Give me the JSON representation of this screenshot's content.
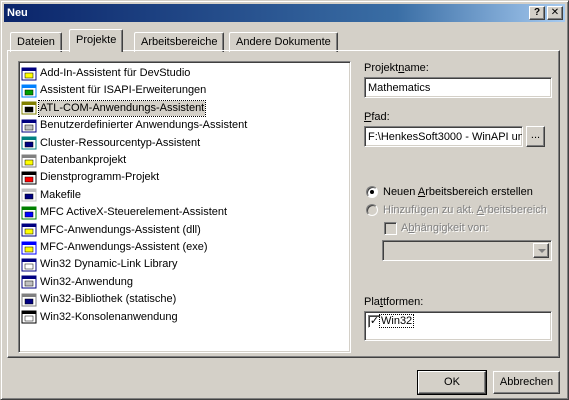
{
  "window": {
    "title": "Neu",
    "help_label": "?",
    "close_label": "✕"
  },
  "tabs": [
    {
      "label": "Dateien"
    },
    {
      "label": "Projekte"
    },
    {
      "label": "Arbeitsbereiche"
    },
    {
      "label": "Andere Dokumente"
    }
  ],
  "project_types": [
    {
      "label": "Add-In-Assistent für DevStudio",
      "icon": "wizard-icon"
    },
    {
      "label": "Assistent für ISAPI-Erweiterungen",
      "icon": "globe-icon"
    },
    {
      "label": "ATL-COM-Anwendungs-Assistent",
      "icon": "atl-icon"
    },
    {
      "label": "Benutzerdefinierter Anwendungs-Assistent",
      "icon": "custom-wizard-icon"
    },
    {
      "label": "Cluster-Ressourcentyp-Assistent",
      "icon": "cluster-icon"
    },
    {
      "label": "Datenbankprojekt",
      "icon": "database-icon"
    },
    {
      "label": "Dienstprogramm-Projekt",
      "icon": "utility-icon"
    },
    {
      "label": "Makefile",
      "icon": "makefile-icon"
    },
    {
      "label": "MFC ActiveX-Steuerelement-Assistent",
      "icon": "activex-icon"
    },
    {
      "label": "MFC-Anwendungs-Assistent (dll)",
      "icon": "mfc-dll-icon"
    },
    {
      "label": "MFC-Anwendungs-Assistent (exe)",
      "icon": "mfc-exe-icon"
    },
    {
      "label": "Win32 Dynamic-Link Library",
      "icon": "dll-icon"
    },
    {
      "label": "Win32-Anwendung",
      "icon": "win32-app-icon"
    },
    {
      "label": "Win32-Bibliothek (statische)",
      "icon": "library-icon"
    },
    {
      "label": "Win32-Konsolenanwendung",
      "icon": "console-icon"
    }
  ],
  "selected_project_index": 2,
  "form": {
    "project_name_label_pre": "Projekt",
    "project_name_label_u": "n",
    "project_name_label_post": "ame:",
    "project_name_value": "Mathematics",
    "path_label_pre": "",
    "path_label_u": "P",
    "path_label_post": "fad:",
    "path_value": "F:\\HenkesSoft3000 - WinAPI un",
    "browse_label": "...",
    "radio_new_pre": "Neuen ",
    "radio_new_u": "A",
    "radio_new_post": "rbeitsbereich erstellen",
    "radio_add_pre": "Hinzufügen zu akt. ",
    "radio_add_u": "A",
    "radio_add_post": "rbeitsbereich",
    "dependency_pre": "A",
    "dependency_u": "b",
    "dependency_post": "hängigkeit von:",
    "platforms_label_pre": "Pla",
    "platforms_label_u": "t",
    "platforms_label_post": "tformen:",
    "platforms": [
      {
        "label": "Win32",
        "checked": true
      }
    ]
  },
  "buttons": {
    "ok": "OK",
    "cancel": "Abbrechen"
  }
}
